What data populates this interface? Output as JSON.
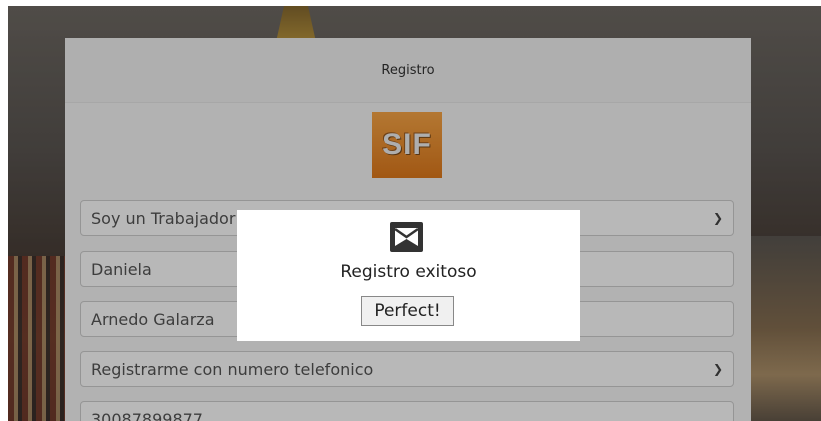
{
  "card": {
    "title": "Registro",
    "logo_text": "SIF"
  },
  "form": {
    "user_type": "Soy un Trabajador independiente",
    "first_name": "Daniela",
    "last_name": "Arnedo Galarza",
    "register_method": "Registrarme con numero telefonico",
    "phone": "30087899877"
  },
  "modal": {
    "icon": "envelope-icon",
    "message": "Registro exitoso",
    "button_label": "Perfect!"
  },
  "colors": {
    "logo_orange": "#f08a2a",
    "modal_bg": "#ffffff"
  }
}
